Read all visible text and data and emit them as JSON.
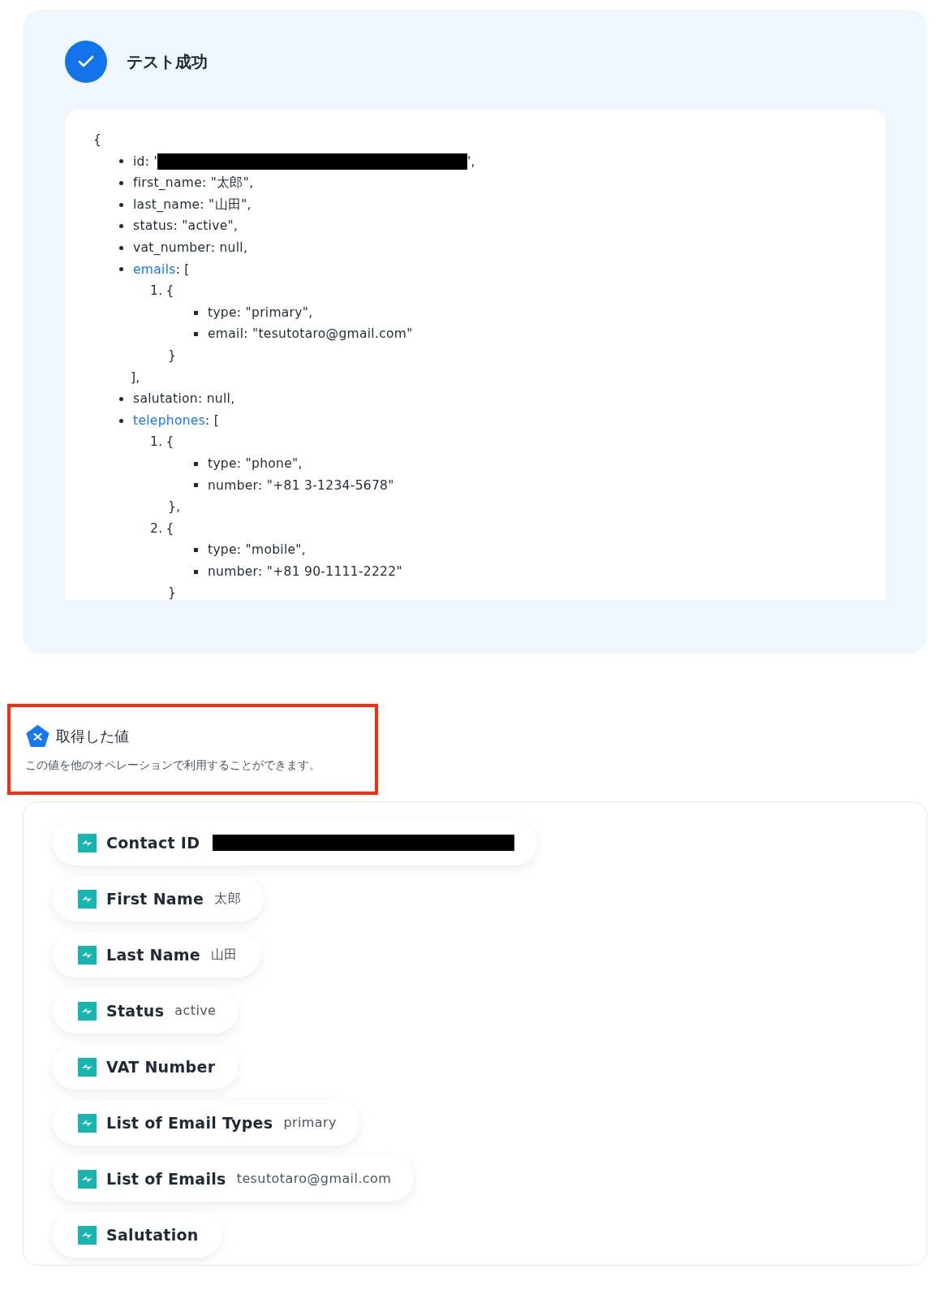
{
  "test_result": {
    "title": "テスト成功",
    "success": true,
    "json_view": {
      "open": "{",
      "items": [
        {
          "text": "id: '",
          "redacted": true,
          "after": "',"
        },
        {
          "text": "first_name: \"太郎\","
        },
        {
          "text": "last_name: \"山田\","
        },
        {
          "text": "status: \"active\","
        },
        {
          "text": "vat_number: null,"
        },
        {
          "link": "emails",
          "text": ": [",
          "close": "],",
          "children": [
            {
              "marker": "1.",
              "text": "{",
              "close": "}",
              "children": [
                {
                  "text": "type: \"primary\","
                },
                {
                  "text": "email: \"tesutotaro@gmail.com\""
                }
              ]
            }
          ]
        },
        {
          "text": "salutation: null,"
        },
        {
          "link": "telephones",
          "text": ": [",
          "children": [
            {
              "marker": "1.",
              "text": "{",
              "close": "},",
              "children": [
                {
                  "text": "type: \"phone\","
                },
                {
                  "text": "number: \"+81 3-1234-5678\""
                }
              ]
            },
            {
              "marker": "2.",
              "text": "{",
              "close": "}",
              "children": [
                {
                  "text": "type: \"mobile\","
                },
                {
                  "text": "number: \"+81 90-1111-2222\""
                }
              ]
            }
          ]
        }
      ]
    }
  },
  "values_section": {
    "title": "取得した値",
    "description": "この値を他のオペレーションで利用することができます。",
    "highlighted": true
  },
  "values": [
    {
      "label": "Contact ID",
      "redacted": true
    },
    {
      "label": "First Name",
      "value": "太郎"
    },
    {
      "label": "Last Name",
      "value": "山田"
    },
    {
      "label": "Status",
      "value": "active"
    },
    {
      "label": "VAT Number"
    },
    {
      "label": "List of Email Types",
      "value": "primary"
    },
    {
      "label": "List of Emails",
      "value": "tesutotaro@gmail.com"
    },
    {
      "label": "Salutation"
    }
  ]
}
